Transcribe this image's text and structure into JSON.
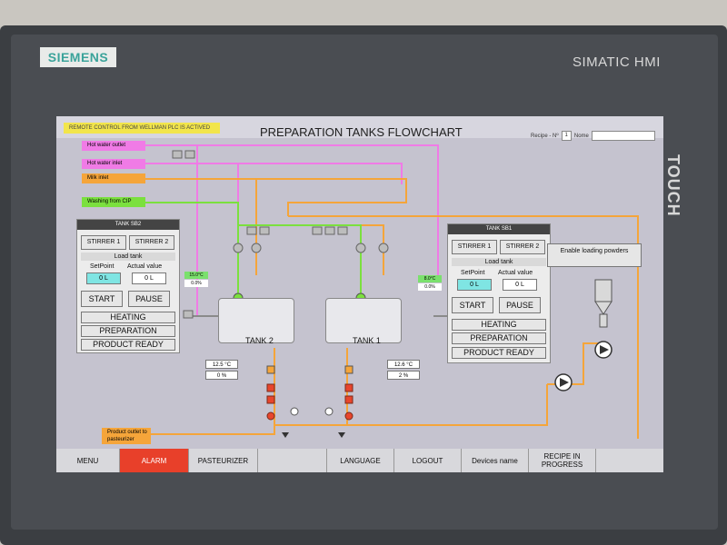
{
  "device": {
    "brand": "SIEMENS",
    "model": "SIMATIC HMI",
    "side_label": "TOUCH"
  },
  "header": {
    "remote_banner": "REMOTE CONTROL FROM WELLMAN PLC IS ACTIVED",
    "title": "PREPARATION TANKS FLOWCHART",
    "recipe_label": "Recipe - Nº",
    "recipe_number": "1",
    "name_label": "Nome",
    "name_value": ""
  },
  "inlets": {
    "hot_water_outlet": "Hot water outlet",
    "hot_water_inlet": "Hot water inlet",
    "milk_inlet": "Milk inlet",
    "washing_from_cip": "Washing from CIP",
    "product_outlet": "Product outlet to pasteurizer"
  },
  "panel_sb2": {
    "title": "TANK SB2",
    "stirrer1": "STIRRER 1",
    "stirrer2": "STIRRER 2",
    "load_tank": "Load tank",
    "setpoint_label": "SetPoint",
    "actual_label": "Actual value",
    "setpoint_value": "0 L",
    "actual_value": "0 L",
    "start": "START",
    "pause": "PAUSE",
    "heating": "HEATING",
    "preparation": "PREPARATION",
    "product_ready": "PRODUCT READY"
  },
  "panel_sb1": {
    "title": "TANK SB1",
    "stirrer1": "STIRRER 1",
    "stirrer2": "STIRRER 2",
    "load_tank": "Load tank",
    "setpoint_label": "SetPoint",
    "actual_label": "Actual value",
    "setpoint_value": "0 L",
    "actual_value": "0 L",
    "start": "START",
    "pause": "PAUSE",
    "heating": "HEATING",
    "preparation": "PREPARATION",
    "product_ready": "PRODUCT READY"
  },
  "powders": {
    "label": "Enable loading powders"
  },
  "tanks": {
    "tank2_label": "TANK 2",
    "tank1_label": "TANK 1",
    "tank2_temp": "12.5 °C",
    "tank2_level": "0 %",
    "tank1_temp": "12.6 °C",
    "tank1_level": "2 %",
    "left_green_temp": "15.0°C",
    "left_green_pct": "0.0%",
    "right_green_temp": "8.0°C",
    "right_green_pct": "0.0%"
  },
  "bottom_nav": {
    "menu": "MENU",
    "alarm": "ALARM",
    "pasteurizer": "PASTEURIZER",
    "language": "LANGUAGE",
    "logout": "LOGOUT",
    "devices": "Devices name",
    "recipe": "RECIPE IN PROGRESS"
  },
  "colors": {
    "hot_water": "#f07be6",
    "milk": "#f5a53a",
    "cip": "#7be03e",
    "alarm": "#e8402a",
    "valve_red": "#e8452c",
    "banner": "#f2e54b"
  }
}
